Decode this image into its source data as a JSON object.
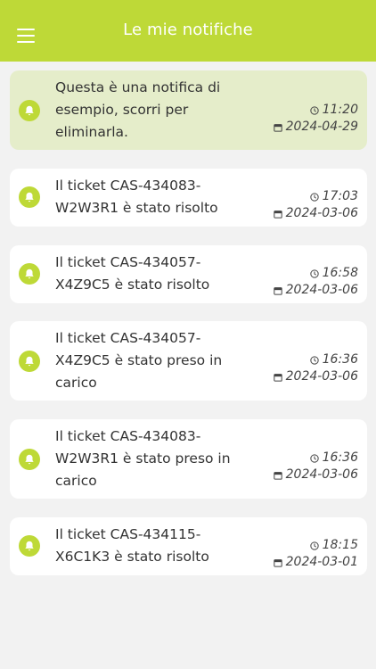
{
  "header": {
    "title": "Le mie notifiche"
  },
  "notifications": [
    {
      "text": "Questa è una notifica di esempio, scorri per eliminarla.",
      "time": "11:20",
      "date": "2024-04-29"
    },
    {
      "text": "Il ticket CAS-434083-W2W3R1 è stato risolto",
      "time": "17:03",
      "date": "2024-03-06"
    },
    {
      "text": "Il ticket CAS-434057-X4Z9C5 è stato risolto",
      "time": "16:58",
      "date": "2024-03-06"
    },
    {
      "text": "Il ticket CAS-434057-X4Z9C5  è stato preso in carico",
      "time": "16:36",
      "date": "2024-03-06"
    },
    {
      "text": "Il ticket CAS-434083-W2W3R1  è stato preso in carico",
      "time": "16:36",
      "date": "2024-03-06"
    },
    {
      "text": "Il ticket CAS-434115-X6C1K3 è stato risolto",
      "time": "18:15",
      "date": "2024-03-01"
    }
  ],
  "colors": {
    "accent": "#bed937",
    "highlight": "#e5edca",
    "background": "#f2f2f2"
  },
  "icons": {
    "menu": "hamburger-menu-icon",
    "bell": "bell-icon",
    "clock": "clock-icon",
    "calendar": "calendar-icon"
  }
}
